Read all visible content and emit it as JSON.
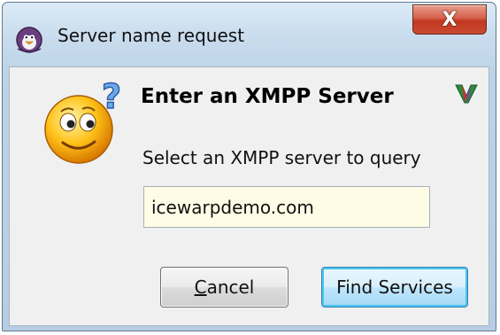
{
  "window": {
    "title": "Server name request",
    "close_label": "X"
  },
  "dialog": {
    "heading": "Enter an XMPP Server",
    "prompt": "Select an XMPP server to query",
    "server_value": "icewarpdemo.com"
  },
  "buttons": {
    "cancel_mnemonic": "C",
    "cancel_rest": "ancel",
    "find_label": "Find Services"
  },
  "icons": {
    "app": "penguin-icon",
    "smiley": "confused-smiley-icon",
    "logo": "v-logo-icon"
  },
  "colors": {
    "input_bg": "#fffce6",
    "close_red": "#c2381f",
    "default_button_border": "#3c7fb1"
  }
}
